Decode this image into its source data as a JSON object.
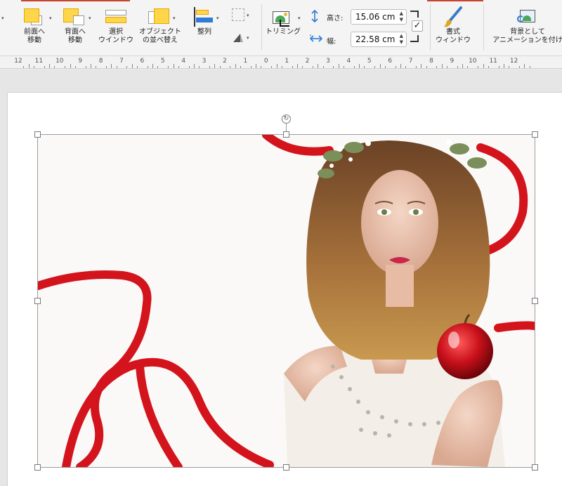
{
  "ribbon": {
    "bring_forward": "前面へ\n移動",
    "send_backward": "背面へ\n移動",
    "selection_pane": "選択\nウインドウ",
    "reorder_objects": "オブジェクト\nの並べ替え",
    "align": "整列",
    "crop": "トリミング",
    "height_label": "高さ:",
    "height_value": "15.06 cm",
    "width_label": "幅:",
    "width_value": "22.58 cm",
    "format_pane": "書式\nウィンドウ",
    "set_as_background": "背景として\nアニメーションを付け"
  },
  "ruler": {
    "labels": [
      "12",
      "11",
      "10",
      "9",
      "8",
      "7",
      "6",
      "5",
      "4",
      "3",
      "2",
      "1",
      "0",
      "1",
      "2",
      "3",
      "4",
      "5",
      "6",
      "7",
      "8",
      "9",
      "10",
      "11",
      "12"
    ]
  },
  "colors": {
    "accent": "#c9432e",
    "ribbon_red": "#d4141c",
    "apple_red": "#c8101a"
  },
  "slide": {
    "image_subject": "woman-with-red-apple-and-ribbon-photo"
  }
}
